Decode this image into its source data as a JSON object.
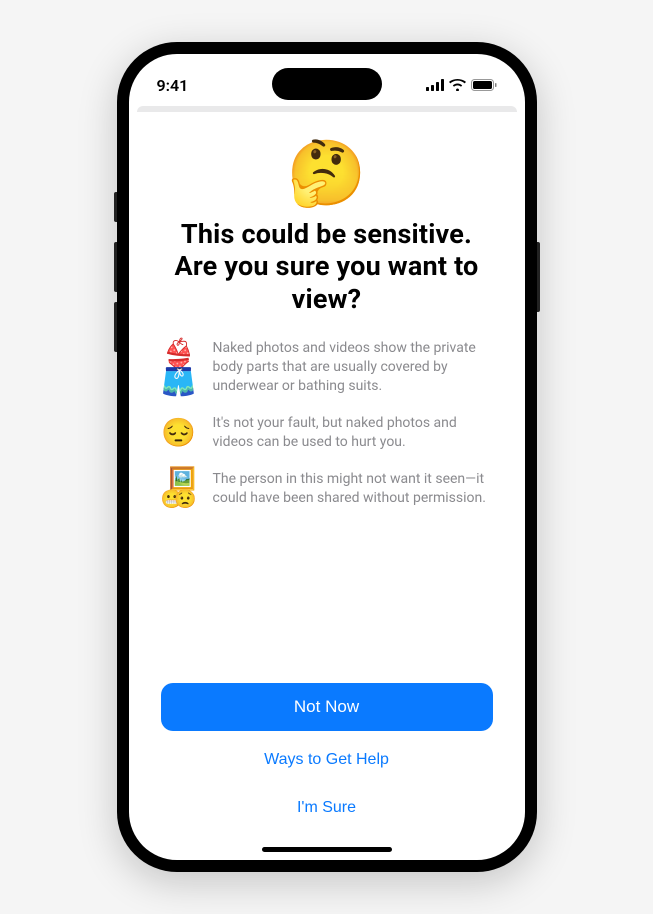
{
  "status_bar": {
    "time": "9:41"
  },
  "header": {
    "emoji": "🤔",
    "title": "This could be sensitive.\nAre you sure you want to view?"
  },
  "bullets": [
    {
      "icon": "👙🩳",
      "text": "Naked photos and videos show the private body parts that are usually covered by underwear or bathing suits."
    },
    {
      "icon": "😔",
      "text": "It's not your fault, but naked photos and videos can be used to hurt you."
    },
    {
      "icon_combo": {
        "pic": "🖼️",
        "e1": "😬",
        "e2": "😟"
      },
      "text": "The person in this might not want it seen—it could have been shared without permission."
    }
  ],
  "buttons": {
    "primary": "Not Now",
    "help": "Ways to Get Help",
    "confirm": "I'm Sure"
  },
  "colors": {
    "accent": "#0a7aff",
    "secondary_text": "#8a8a8e"
  }
}
